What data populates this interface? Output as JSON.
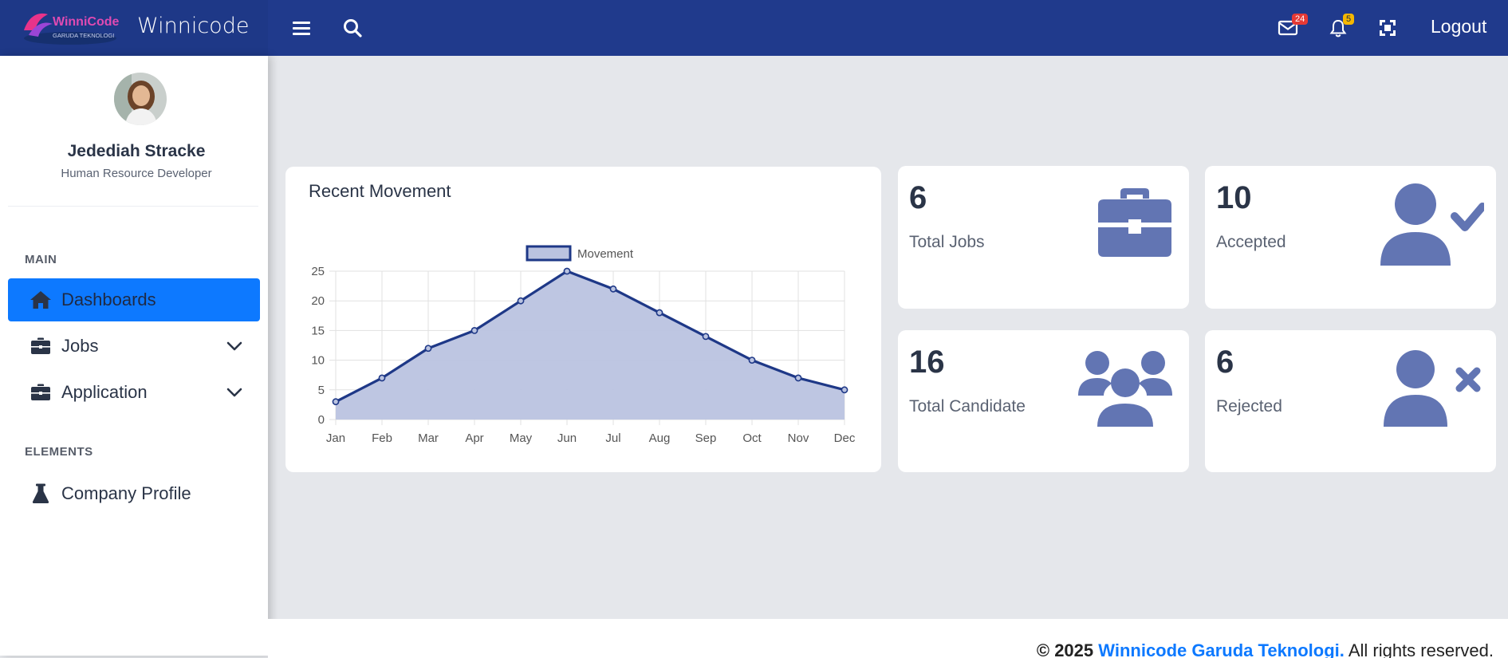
{
  "brand": {
    "logo_text": "WinniCode",
    "logo_subtext": "GARUDA TEKNOLOGI",
    "name": "Winnicode"
  },
  "topbar": {
    "icons": [
      "menu-icon",
      "search-icon",
      "mail-icon",
      "bell-icon",
      "fullscreen-icon"
    ],
    "mail_badge": "24",
    "bell_badge": "5",
    "logout_label": "Logout",
    "colors": {
      "bar": "#203a8c",
      "mail_badge": "#e53935",
      "bell_badge": "#f5b700"
    }
  },
  "sidebar": {
    "user": {
      "name": "Jedediah Stracke",
      "role": "Human Resource Developer"
    },
    "section_main": "MAIN",
    "section_elements": "ELEMENTS",
    "items": [
      {
        "label": "Dashboards",
        "icon": "home-icon",
        "active": true
      },
      {
        "label": "Jobs",
        "icon": "briefcase-icon",
        "has_submenu": true
      },
      {
        "label": "Application",
        "icon": "briefcase-icon",
        "has_submenu": true
      },
      {
        "label": "Company Profile",
        "icon": "flask-icon"
      }
    ],
    "active_color": "#0d79ff"
  },
  "chart_card": {
    "title": "Recent Movement"
  },
  "chart_data": {
    "type": "area",
    "categories": [
      "Jan",
      "Feb",
      "Mar",
      "Apr",
      "May",
      "Jun",
      "Jul",
      "Aug",
      "Sep",
      "Oct",
      "Nov",
      "Dec"
    ],
    "series": [
      {
        "name": "Movement",
        "values": [
          3,
          7,
          12,
          15,
          20,
          25,
          22,
          18,
          14,
          10,
          7,
          5
        ],
        "color": "#1e3887",
        "fill": "#bac3e0"
      }
    ],
    "y_ticks": [
      "0",
      "5",
      "10",
      "15",
      "20",
      "25"
    ],
    "ylim": [
      0,
      25
    ],
    "grid": true,
    "legend": "top-center"
  },
  "stats": [
    {
      "value": "6",
      "label": "Total Jobs",
      "icon": "briefcase-icon"
    },
    {
      "value": "10",
      "label": "Accepted",
      "icon": "user-check-icon"
    },
    {
      "value": "16",
      "label": "Total Candidate",
      "icon": "users-icon"
    },
    {
      "value": "6",
      "label": "Rejected",
      "icon": "user-xmark-icon"
    }
  ],
  "stat_icon_color": "#6275b3",
  "footer": {
    "copyright": "© 2025",
    "company": "Winnicode Garuda Teknologi.",
    "rights": "All rights reserved."
  }
}
